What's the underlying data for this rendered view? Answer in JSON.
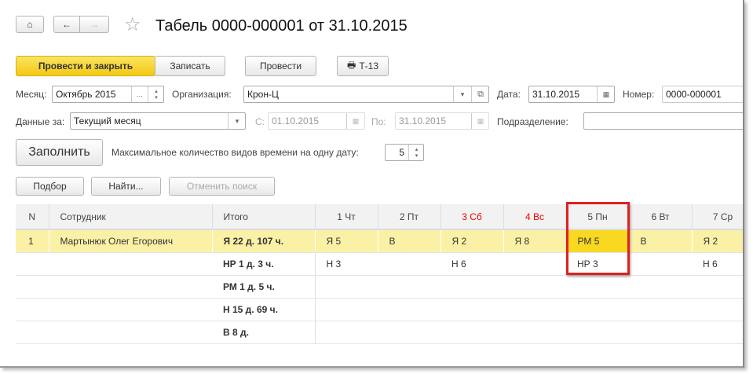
{
  "title": "Табель 0000-000001 от 31.10.2015",
  "toolbar": {
    "post_close": "Провести и закрыть",
    "save": "Записать",
    "post": "Провести",
    "print": "Т-13"
  },
  "fields": {
    "month_label": "Месяц:",
    "month_value": "Октябрь 2015",
    "org_label": "Организация:",
    "org_value": "Крон-Ц",
    "date_label": "Дата:",
    "date_value": "31.10.2015",
    "number_label": "Номер:",
    "number_value": "0000-000001",
    "data_for_label": "Данные за:",
    "data_for_value": "Текущий месяц",
    "from_label": "С:",
    "from_value": "01.10.2015",
    "to_label": "По:",
    "to_value": "31.10.2015",
    "dept_label": "Подразделение:",
    "dept_value": "",
    "max_types_label": "Максимальное количество видов времени на одну дату:",
    "max_types_value": "5",
    "dots": "..."
  },
  "buttons": {
    "fill": "Заполнить",
    "select": "Подбор",
    "find": "Найти...",
    "cancel_search": "Отменить поиск"
  },
  "table": {
    "headers": [
      "N",
      "Сотрудник",
      "Итого",
      "1 Чт",
      "2 Пт",
      "3 Сб",
      "4 Вс",
      "5 Пн",
      "6 Вт",
      "7 Ср"
    ],
    "rows": [
      [
        "1",
        "Мартынюк Олег Егорович",
        "Я 22 д. 107 ч.",
        "Я 5",
        "В",
        "Я 2",
        "Я 8",
        "РМ 5",
        "В",
        "Я 2"
      ],
      [
        "",
        "",
        "НР 1 д. 3 ч.",
        "Н 3",
        "",
        "Н 6",
        "",
        "НР 3",
        "",
        "Н 6"
      ],
      [
        "",
        "",
        "РМ 1 д. 5 ч.",
        "",
        "",
        "",
        "",
        "",
        "",
        ""
      ],
      [
        "",
        "",
        "Н 15 д. 69 ч.",
        "",
        "",
        "",
        "",
        "",
        "",
        ""
      ],
      [
        "",
        "",
        "В 8 д.",
        "",
        "",
        "",
        "",
        "",
        "",
        ""
      ]
    ]
  }
}
